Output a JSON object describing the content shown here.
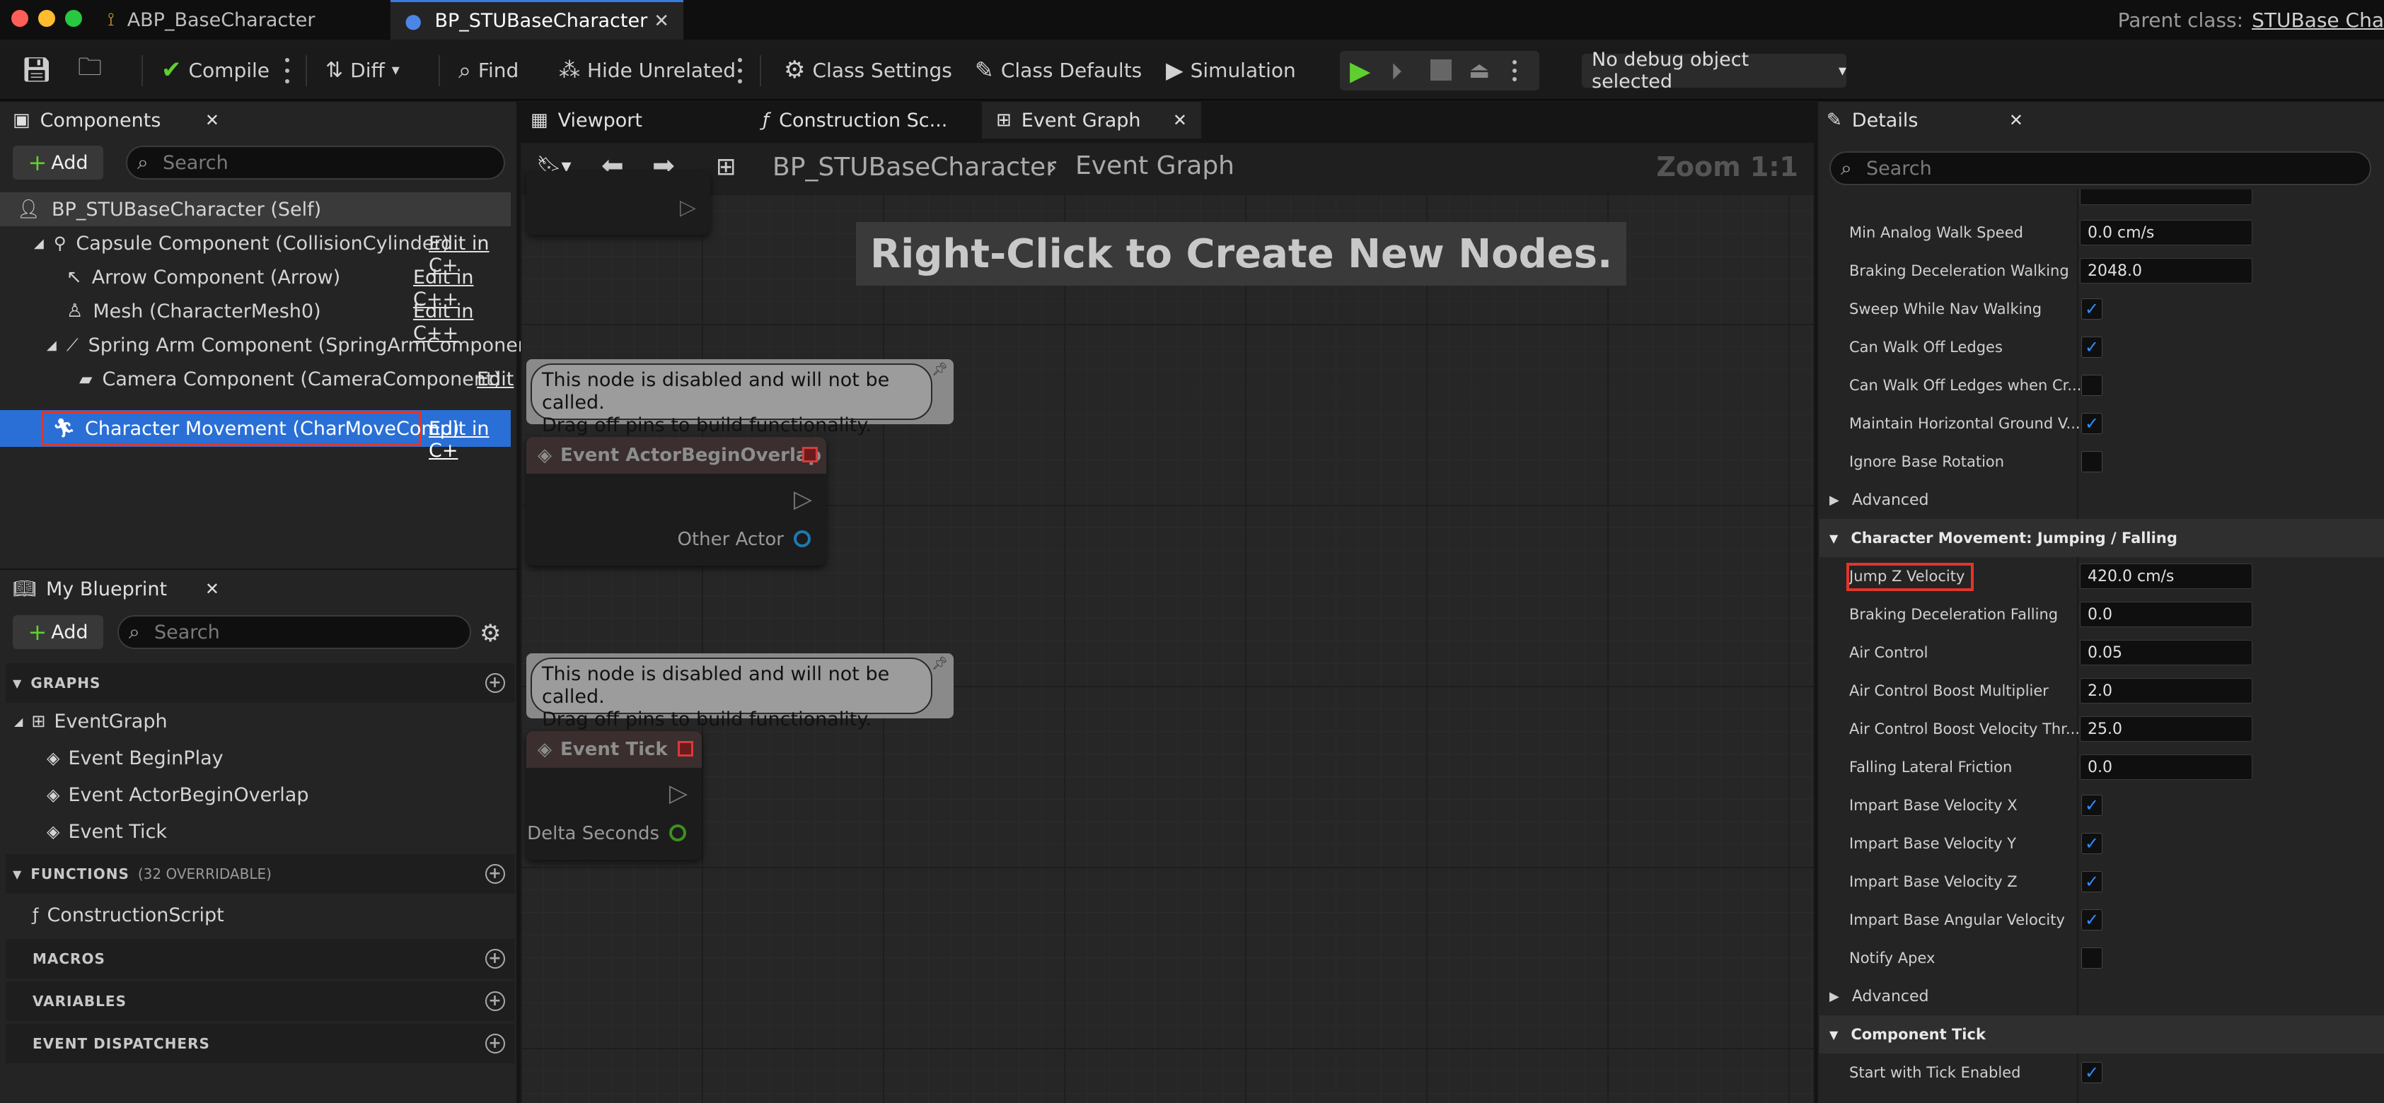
{
  "titlebar": {
    "tab1": "ABP_BaseCharacter",
    "tab2": "BP_STUBaseCharacter",
    "parent_label": "Parent class:",
    "parent_value": "STUBase Cha"
  },
  "toolbar": {
    "compile": "Compile",
    "diff": "Diff",
    "find": "Find",
    "hide_unrelated": "Hide Unrelated",
    "class_settings": "Class Settings",
    "class_defaults": "Class Defaults",
    "simulation": "Simulation",
    "debug_select": "No debug object selected"
  },
  "components": {
    "title": "Components",
    "add": "Add",
    "search_placeholder": "Search",
    "items": [
      {
        "label": "BP_STUBaseCharacter (Self)",
        "edit": ""
      },
      {
        "label": "Capsule Component (CollisionCylinder)",
        "edit": "Edit in C+"
      },
      {
        "label": "Arrow Component (Arrow)",
        "edit": "Edit in C++"
      },
      {
        "label": "Mesh (CharacterMesh0)",
        "edit": "Edit in C++"
      },
      {
        "label": "Spring Arm Component (SpringArmComponent)",
        "edit": ""
      },
      {
        "label": "Camera Component (CameraComponent)",
        "edit": "Edit"
      },
      {
        "label": "Character Movement (CharMoveComp)",
        "edit": "Edit in C+"
      }
    ]
  },
  "myblueprint": {
    "title": "My Blueprint",
    "add": "Add",
    "search_placeholder": "Search",
    "graphs_header": "GRAPHS",
    "eventgraph": "EventGraph",
    "events": [
      "Event BeginPlay",
      "Event ActorBeginOverlap",
      "Event Tick"
    ],
    "functions_header": "FUNCTIONS",
    "functions_count": "(32 OVERRIDABLE)",
    "construction": "ConstructionScript",
    "macros": "MACROS",
    "variables": "VARIABLES",
    "dispatchers": "EVENT DISPATCHERS"
  },
  "graph": {
    "tabs": [
      "Viewport",
      "Construction Sc...",
      "Event Graph"
    ],
    "breadcrumb_bp": "BP_STUBaseCharacter",
    "breadcrumb_graph": "Event Graph",
    "zoom": "Zoom 1:1",
    "hint": "Right-Click to Create New Nodes.",
    "disabled_line1": "This node is disabled and will not be called.",
    "disabled_line2": "Drag off pins to build functionality.",
    "node1_title": "Event ActorBeginOverlap",
    "node1_pin": "Other Actor",
    "node2_title": "Event Tick",
    "node2_pin": "Delta Seconds"
  },
  "details": {
    "title": "Details",
    "search_placeholder": "Search",
    "rows": [
      {
        "label": "Min Analog Walk Speed",
        "value": "0.0 cm/s"
      },
      {
        "label": "Braking Deceleration Walking",
        "value": "2048.0"
      },
      {
        "label": "Sweep While Nav Walking",
        "check": true
      },
      {
        "label": "Can Walk Off Ledges",
        "check": true
      },
      {
        "label": "Can Walk Off Ledges when Cr...",
        "check": false
      },
      {
        "label": "Maintain Horizontal Ground V...",
        "check": true
      },
      {
        "label": "Ignore Base Rotation",
        "check": false
      }
    ],
    "advanced": "Advanced",
    "section_jump": "Character Movement: Jumping / Falling",
    "jump_rows": [
      {
        "label": "Jump Z Velocity",
        "value": "420.0 cm/s"
      },
      {
        "label": "Braking Deceleration Falling",
        "value": "0.0"
      },
      {
        "label": "Air Control",
        "value": "0.05"
      },
      {
        "label": "Air Control Boost Multiplier",
        "value": "2.0"
      },
      {
        "label": "Air Control Boost Velocity Thr...",
        "value": "25.0"
      },
      {
        "label": "Falling Lateral Friction",
        "value": "0.0"
      },
      {
        "label": "Impart Base Velocity X",
        "check": true
      },
      {
        "label": "Impart Base Velocity Y",
        "check": true
      },
      {
        "label": "Impart Base Velocity Z",
        "check": true
      },
      {
        "label": "Impart Base Angular Velocity",
        "check": true
      },
      {
        "label": "Notify Apex",
        "check": false
      }
    ],
    "section_tick": "Component Tick",
    "tick_row": {
      "label": "Start with Tick Enabled",
      "check": true
    }
  },
  "colors": {
    "accent_blue": "#2a6fd6",
    "highlight_red": "#e0362a",
    "play_green": "#5fcf2f"
  }
}
